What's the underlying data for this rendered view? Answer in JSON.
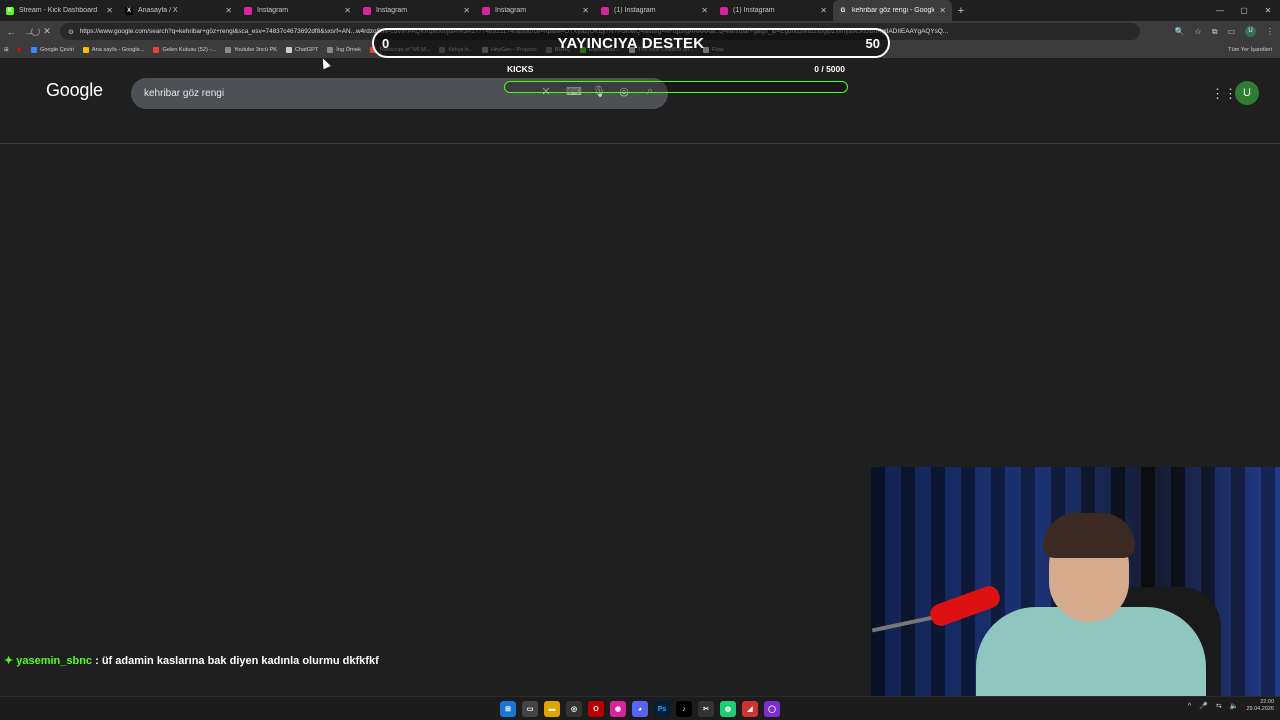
{
  "tabs": [
    {
      "label": "Stream - Kick Dashboard",
      "icon": "kick-icon",
      "color": "#53fc18",
      "glyph": "K"
    },
    {
      "label": "Anasayfa / X",
      "icon": "x-icon",
      "color": "#000000",
      "glyph": "X"
    },
    {
      "label": "Instagram",
      "icon": "instagram-icon",
      "color": "#d6249f",
      "glyph": ""
    },
    {
      "label": "Instagram",
      "icon": "instagram-icon",
      "color": "#d6249f",
      "glyph": ""
    },
    {
      "label": "Instagram",
      "icon": "instagram-icon",
      "color": "#d6249f",
      "glyph": ""
    },
    {
      "label": "(1) Instagram",
      "icon": "instagram-icon",
      "color": "#d6249f",
      "glyph": ""
    },
    {
      "label": "(1) Instagram",
      "icon": "instagram-icon",
      "color": "#d6249f",
      "glyph": ""
    },
    {
      "label": "kehribar göz rengi - Google'da...",
      "icon": "google-icon",
      "color": "#444444",
      "glyph": "G",
      "active": true
    }
  ],
  "address_bar": {
    "url": "https://www.google.com/search?q=kehribar+göz+rengi&sca_esv=74837c4673692df8&sxsrf=AN...w4rdzoStnPcdVlRPAQKKqMXi0jfsA%3A1777489211740&source=hp&ei=OTXyaZjOKtqi7NYP5f0wQ4&iflsig=AFdpzrgAAAAAaf..q=kehribar+g&gs_lp=Egdnd3Mtd2l6IglpZWhyaWJhciBnKgIIADIIEAAYgAQYsQ..."
  },
  "bookmarks": [
    {
      "label": "Google Çeviri",
      "color": "#4285f4"
    },
    {
      "label": "Ana sayfa - Google...",
      "color": "#fbbc05"
    },
    {
      "label": "Gelen Kutusu (52) -...",
      "color": "#ea4335"
    },
    {
      "label": "Youtube 3ncü PK",
      "color": "#888888"
    },
    {
      "label": "ChatGPT",
      "color": "#cccccc"
    },
    {
      "label": "İng Örnek",
      "color": "#888888"
    },
    {
      "label": "Transcript of \"MI M...",
      "color": "#ea4335"
    },
    {
      "label": "türkçe h...",
      "color": "#888888"
    },
    {
      "label": "HeyGen - Projects",
      "color": "#aaaaaa"
    },
    {
      "label": "BURÇ",
      "color": "#888888"
    },
    {
      "label": "Esperanza...",
      "color": "#53fc18"
    },
    {
      "label": "The best ChatBot an...",
      "color": "#ffffff"
    },
    {
      "label": "Flow",
      "color": "#ffffff"
    }
  ],
  "bookmarks_all": "Tüm Yer İşaretleri",
  "google": {
    "logo": "Google",
    "query": "kehribar göz rengi",
    "avatar": "U"
  },
  "overlay": {
    "title": "YAYINCIYA DESTEK",
    "left_num": "0",
    "right_num": "50",
    "kicks_label": "KICKS",
    "kicks_count": "0 / 5000",
    "kicks_progress": 0,
    "accent": "#53fc18"
  },
  "chat": {
    "user": "yasemin_sbnc",
    "message": " : üf adamin kaslarına bak diyen kadınla olurmu dkfkfkf"
  },
  "taskbar": {
    "time": "22:00",
    "date": "29.04.2026"
  }
}
